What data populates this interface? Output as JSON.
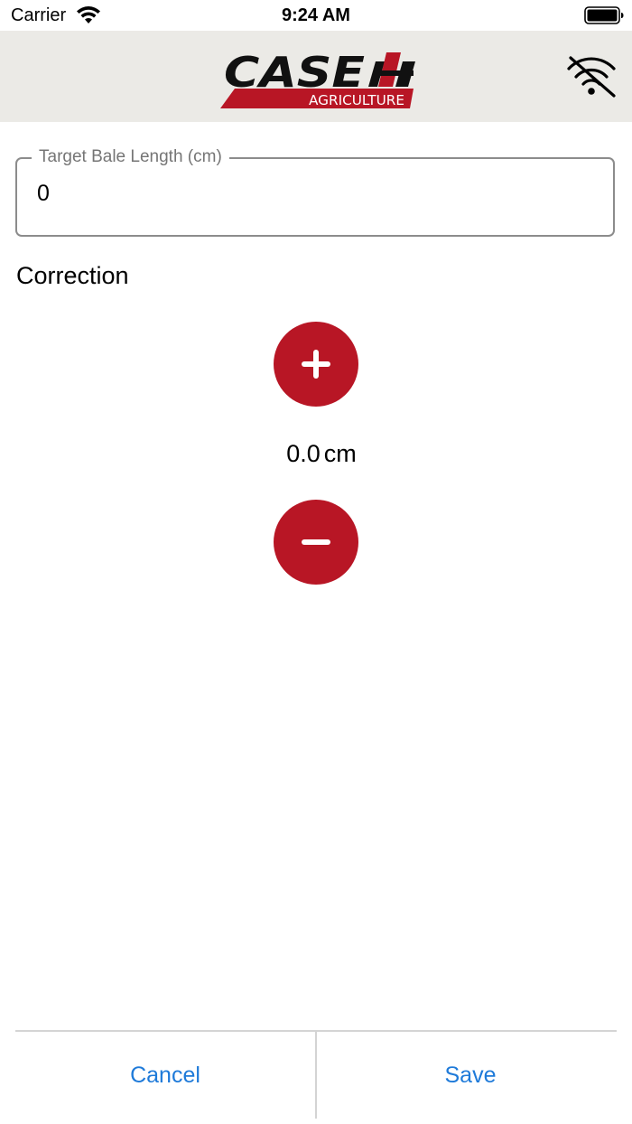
{
  "status_bar": {
    "carrier": "Carrier",
    "time": "9:24 AM"
  },
  "header": {
    "logo_text": "CASE",
    "logo_subtitle": "AGRICULTURE",
    "connection_icon": "wifi-off-icon",
    "brand_color": "#b81625"
  },
  "form": {
    "target_label": "Target Bale Length (cm)",
    "target_value": "0"
  },
  "correction": {
    "title": "Correction",
    "value": "0.0",
    "unit": "cm",
    "increase_icon": "plus-icon",
    "decrease_icon": "minus-icon"
  },
  "actions": {
    "cancel_label": "Cancel",
    "save_label": "Save",
    "link_color": "#1e7ad9"
  }
}
